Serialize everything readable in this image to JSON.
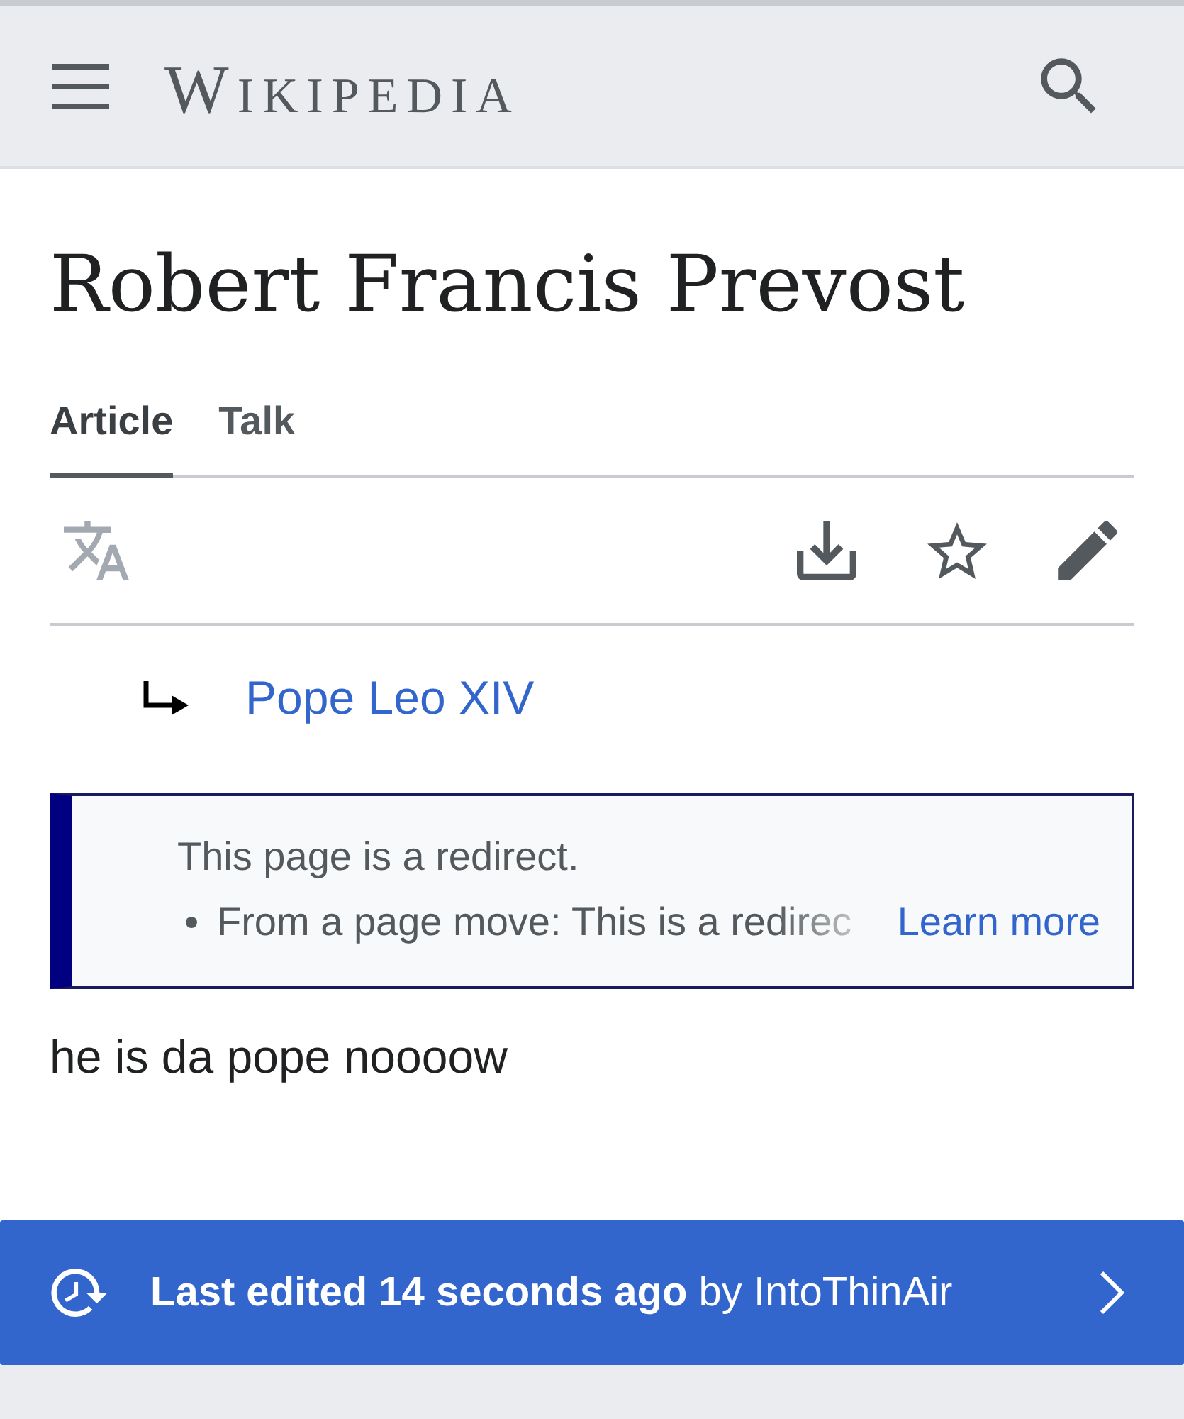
{
  "header": {
    "logo": "WIKIPEDIA"
  },
  "title": "Robert Francis Prevost",
  "tabs": [
    {
      "label": "Article",
      "selected": true
    },
    {
      "label": "Talk",
      "selected": false
    }
  ],
  "page_actions": {
    "language_disabled": true
  },
  "redirect": {
    "target": "Pope Leo XIV"
  },
  "notice": {
    "heading": "This page is a redirect.",
    "items": [
      "From a page move: This is a redirec"
    ],
    "link": "Learn more"
  },
  "body": "he is da pope noooow",
  "last_edited": {
    "text": "**Last edited 14 seconds ago** by IntoThinAir"
  }
}
